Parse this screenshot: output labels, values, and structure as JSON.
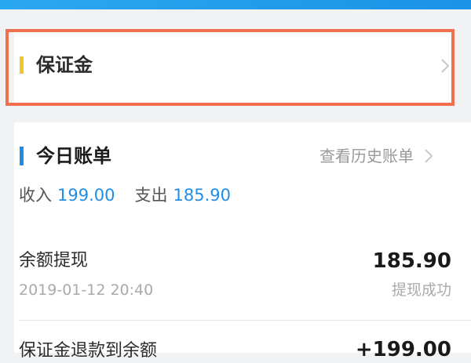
{
  "deposit_section": {
    "title": "保证金"
  },
  "bill_section": {
    "title": "今日账单",
    "history_link": "查看历史账单",
    "income_label": "收入",
    "income_value": "199.00",
    "expense_label": "支出",
    "expense_value": "185.90"
  },
  "transactions": [
    {
      "title": "余额提现",
      "time": "2019-01-12 20:40",
      "amount": "185.90",
      "status": "提现成功"
    },
    {
      "title": "保证金退款到余额",
      "amount": "+199.00"
    }
  ],
  "colors": {
    "top_bar": "#1c93e6",
    "highlight_border": "#f0704e",
    "deposit_accent": "#f2c623",
    "bill_accent": "#1f8ee8",
    "value_blue": "#1f8ee8"
  },
  "icons": {
    "deposit_chevron": "chevron-right-icon",
    "history_chevron": "chevron-right-icon"
  }
}
